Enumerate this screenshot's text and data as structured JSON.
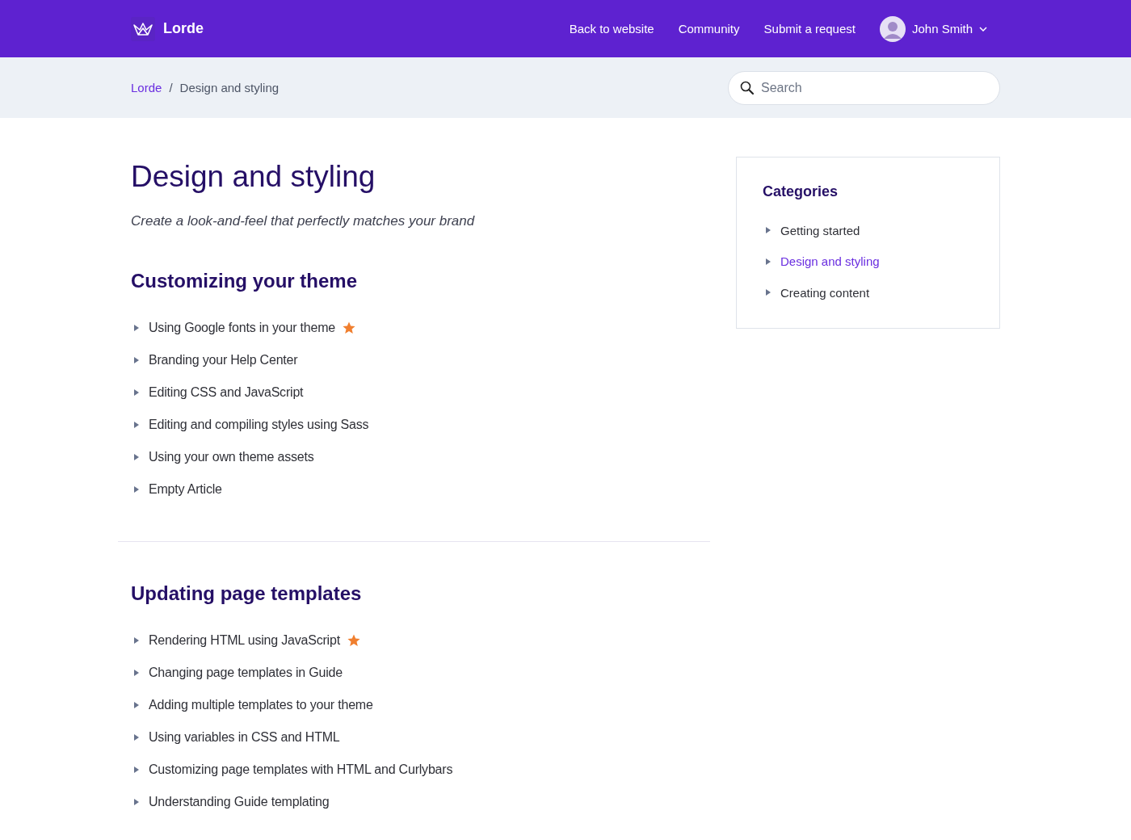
{
  "header": {
    "brand": "Lorde",
    "nav": [
      "Back to website",
      "Community",
      "Submit a request"
    ],
    "user": {
      "name": "John Smith"
    }
  },
  "breadcrumbs": [
    "Lorde",
    "Design and styling"
  ],
  "breadcrumb_separator": "/",
  "search": {
    "placeholder": "Search"
  },
  "page": {
    "title": "Design and styling",
    "subtitle": "Create a look-and-feel that perfectly matches your brand"
  },
  "sections": [
    {
      "title": "Customizing your theme",
      "articles": [
        {
          "title": "Using Google fonts in your theme",
          "promoted": true
        },
        {
          "title": "Branding your Help Center",
          "promoted": false
        },
        {
          "title": "Editing CSS and JavaScript",
          "promoted": false
        },
        {
          "title": "Editing and compiling styles using Sass",
          "promoted": false
        },
        {
          "title": "Using your own theme assets",
          "promoted": false
        },
        {
          "title": "Empty Article",
          "promoted": false
        }
      ]
    },
    {
      "title": "Updating page templates",
      "articles": [
        {
          "title": "Rendering HTML using JavaScript",
          "promoted": true
        },
        {
          "title": "Changing page templates in Guide",
          "promoted": false
        },
        {
          "title": "Adding multiple templates to your theme",
          "promoted": false
        },
        {
          "title": "Using variables in CSS and HTML",
          "promoted": false
        },
        {
          "title": "Customizing page templates with HTML and Curlybars",
          "promoted": false
        },
        {
          "title": "Understanding Guide templating",
          "promoted": false
        }
      ]
    }
  ],
  "sidebar": {
    "title": "Categories",
    "items": [
      {
        "label": "Getting started",
        "selected": false
      },
      {
        "label": "Design and styling",
        "selected": true
      },
      {
        "label": "Creating content",
        "selected": false
      }
    ]
  }
}
